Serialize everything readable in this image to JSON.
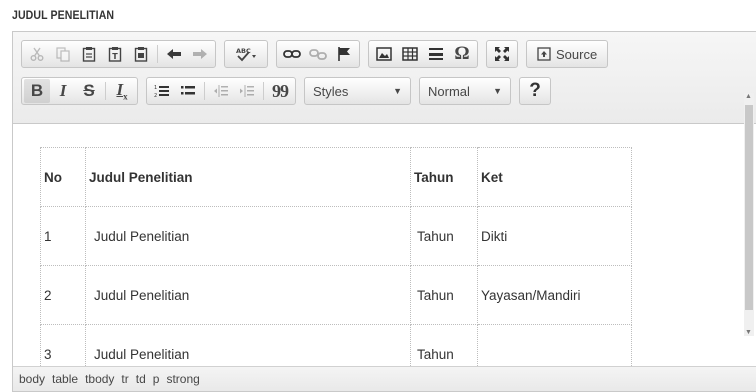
{
  "field": {
    "label": "JUDUL PENELITIAN"
  },
  "toolbar": {
    "source_label": "Source",
    "styles_label": "Styles",
    "format_label": "Normal",
    "help_label": "?",
    "bold_label": "B",
    "italic_label": "I",
    "strike_label": "S",
    "blockquote_label": "99",
    "omega_label": "Ω",
    "removeformat_label": "I",
    "removeformat_sub": "x"
  },
  "table": {
    "header": [
      "No",
      "Judul Penelitian",
      "Tahun",
      "Ket"
    ],
    "rows": [
      [
        "1",
        "Judul Penelitian",
        "Tahun",
        "Dikti"
      ],
      [
        "2",
        "Judul Penelitian",
        "Tahun",
        "Yayasan/Mandiri"
      ],
      [
        "3",
        "Judul Penelitian",
        "Tahun",
        ""
      ]
    ]
  },
  "pathbar": {
    "items": [
      "body",
      "table",
      "tbody",
      "tr",
      "td",
      "p",
      "strong"
    ]
  },
  "colors": {
    "toolbar_bg": "#ebebeb",
    "border": "#c9c9c9",
    "text": "#333333"
  }
}
